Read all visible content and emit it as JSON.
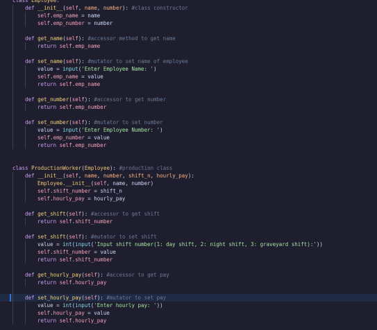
{
  "editor": {
    "lines": [
      {
        "indent": 0,
        "tokens": [
          [
            "kw",
            "class "
          ],
          [
            "cls",
            "Employee"
          ],
          [
            "op",
            ":"
          ]
        ]
      },
      {
        "indent": 1,
        "tokens": [
          [
            "kw",
            "def "
          ],
          [
            "fn",
            "__init__"
          ],
          [
            "op",
            "("
          ],
          [
            "self",
            "self"
          ],
          [
            "op",
            ", "
          ],
          [
            "par",
            "name"
          ],
          [
            "op",
            ", "
          ],
          [
            "par",
            "number"
          ],
          [
            "op",
            "): "
          ],
          [
            "com",
            "#class constructor"
          ]
        ]
      },
      {
        "indent": 2,
        "tokens": [
          [
            "self",
            "self"
          ],
          [
            "op",
            "."
          ],
          [
            "attr",
            "emp_name"
          ],
          [
            "op",
            " = "
          ],
          [
            "var",
            "name"
          ]
        ]
      },
      {
        "indent": 2,
        "tokens": [
          [
            "self",
            "self"
          ],
          [
            "op",
            "."
          ],
          [
            "attr",
            "emp_number"
          ],
          [
            "op",
            " = "
          ],
          [
            "var",
            "number"
          ]
        ]
      },
      {
        "indent": 1,
        "tokens": []
      },
      {
        "indent": 1,
        "tokens": [
          [
            "kw",
            "def "
          ],
          [
            "fn",
            "get_name"
          ],
          [
            "op",
            "("
          ],
          [
            "self",
            "self"
          ],
          [
            "op",
            "): "
          ],
          [
            "com",
            "#accessor method to get name"
          ]
        ]
      },
      {
        "indent": 2,
        "tokens": [
          [
            "kw",
            "return "
          ],
          [
            "self",
            "self"
          ],
          [
            "op",
            "."
          ],
          [
            "attr",
            "emp_name"
          ]
        ]
      },
      {
        "indent": 1,
        "tokens": []
      },
      {
        "indent": 1,
        "tokens": [
          [
            "kw",
            "def "
          ],
          [
            "fn",
            "set_name"
          ],
          [
            "op",
            "("
          ],
          [
            "self",
            "self"
          ],
          [
            "op",
            "): "
          ],
          [
            "com",
            "#mutator to set name of employee"
          ]
        ]
      },
      {
        "indent": 2,
        "tokens": [
          [
            "var",
            "value"
          ],
          [
            "op",
            " = "
          ],
          [
            "bi",
            "input"
          ],
          [
            "op",
            "("
          ],
          [
            "str",
            "'Enter Employee Name: '"
          ],
          [
            "op",
            ")"
          ]
        ]
      },
      {
        "indent": 2,
        "tokens": [
          [
            "self",
            "self"
          ],
          [
            "op",
            "."
          ],
          [
            "attr",
            "emp_name"
          ],
          [
            "op",
            " = "
          ],
          [
            "var",
            "value"
          ]
        ]
      },
      {
        "indent": 2,
        "tokens": [
          [
            "kw",
            "return "
          ],
          [
            "self",
            "self"
          ],
          [
            "op",
            "."
          ],
          [
            "attr",
            "emp_name"
          ]
        ]
      },
      {
        "indent": 1,
        "tokens": []
      },
      {
        "indent": 1,
        "tokens": [
          [
            "kw",
            "def "
          ],
          [
            "fn",
            "get_number"
          ],
          [
            "op",
            "("
          ],
          [
            "self",
            "self"
          ],
          [
            "op",
            "): "
          ],
          [
            "com",
            "#accessor to get number"
          ]
        ]
      },
      {
        "indent": 2,
        "tokens": [
          [
            "kw",
            "return "
          ],
          [
            "self",
            "self"
          ],
          [
            "op",
            "."
          ],
          [
            "attr",
            "emp_number"
          ]
        ]
      },
      {
        "indent": 1,
        "tokens": []
      },
      {
        "indent": 1,
        "tokens": [
          [
            "kw",
            "def "
          ],
          [
            "fn",
            "set_number"
          ],
          [
            "op",
            "("
          ],
          [
            "self",
            "self"
          ],
          [
            "op",
            "): "
          ],
          [
            "com",
            "#mutator to set number"
          ]
        ]
      },
      {
        "indent": 2,
        "tokens": [
          [
            "var",
            "value"
          ],
          [
            "op",
            " = "
          ],
          [
            "bi",
            "input"
          ],
          [
            "op",
            "("
          ],
          [
            "str",
            "'Enter Employee Number: '"
          ],
          [
            "op",
            ")"
          ]
        ]
      },
      {
        "indent": 2,
        "tokens": [
          [
            "self",
            "self"
          ],
          [
            "op",
            "."
          ],
          [
            "attr",
            "emp_number"
          ],
          [
            "op",
            " = "
          ],
          [
            "var",
            "value"
          ]
        ]
      },
      {
        "indent": 2,
        "tokens": [
          [
            "kw",
            "return "
          ],
          [
            "self",
            "self"
          ],
          [
            "op",
            "."
          ],
          [
            "attr",
            "emp_number"
          ]
        ]
      },
      {
        "indent": 0,
        "tokens": []
      },
      {
        "indent": 0,
        "tokens": []
      },
      {
        "indent": 0,
        "tokens": [
          [
            "kw",
            "class "
          ],
          [
            "cls",
            "ProductionWorker"
          ],
          [
            "op",
            "("
          ],
          [
            "cls",
            "Employee"
          ],
          [
            "op",
            "): "
          ],
          [
            "com",
            "#production class"
          ]
        ]
      },
      {
        "indent": 1,
        "tokens": [
          [
            "kw",
            "def "
          ],
          [
            "fn",
            "__init__"
          ],
          [
            "op",
            "("
          ],
          [
            "self",
            "self"
          ],
          [
            "op",
            ", "
          ],
          [
            "par",
            "name"
          ],
          [
            "op",
            ", "
          ],
          [
            "par",
            "number"
          ],
          [
            "op",
            ", "
          ],
          [
            "par",
            "shift_n"
          ],
          [
            "op",
            ", "
          ],
          [
            "par",
            "hourly_pay"
          ],
          [
            "op",
            "):"
          ]
        ]
      },
      {
        "indent": 2,
        "tokens": [
          [
            "cls",
            "Employee"
          ],
          [
            "op",
            "."
          ],
          [
            "fn",
            "__init__"
          ],
          [
            "op",
            "("
          ],
          [
            "self",
            "self"
          ],
          [
            "op",
            ", "
          ],
          [
            "var",
            "name"
          ],
          [
            "op",
            ", "
          ],
          [
            "var",
            "number"
          ],
          [
            "op",
            ")"
          ]
        ]
      },
      {
        "indent": 2,
        "tokens": [
          [
            "self",
            "self"
          ],
          [
            "op",
            "."
          ],
          [
            "attr",
            "shift_number"
          ],
          [
            "op",
            " = "
          ],
          [
            "var",
            "shift_n"
          ]
        ]
      },
      {
        "indent": 2,
        "tokens": [
          [
            "self",
            "self"
          ],
          [
            "op",
            "."
          ],
          [
            "attr",
            "hourly_pay"
          ],
          [
            "op",
            " = "
          ],
          [
            "var",
            "hourly_pay"
          ]
        ]
      },
      {
        "indent": 1,
        "tokens": []
      },
      {
        "indent": 1,
        "tokens": [
          [
            "kw",
            "def "
          ],
          [
            "fn",
            "get_shift"
          ],
          [
            "op",
            "("
          ],
          [
            "self",
            "self"
          ],
          [
            "op",
            "): "
          ],
          [
            "com",
            "#accessor to get shift"
          ]
        ]
      },
      {
        "indent": 2,
        "tokens": [
          [
            "kw",
            "return "
          ],
          [
            "self",
            "self"
          ],
          [
            "op",
            "."
          ],
          [
            "attr",
            "shift_number"
          ]
        ]
      },
      {
        "indent": 1,
        "tokens": []
      },
      {
        "indent": 1,
        "tokens": [
          [
            "kw",
            "def "
          ],
          [
            "fn",
            "set_shift"
          ],
          [
            "op",
            "("
          ],
          [
            "self",
            "self"
          ],
          [
            "op",
            "): "
          ],
          [
            "com",
            "#mutator to set shift"
          ]
        ]
      },
      {
        "indent": 2,
        "tokens": [
          [
            "var",
            "value"
          ],
          [
            "op",
            " = "
          ],
          [
            "bi",
            "int"
          ],
          [
            "op",
            "("
          ],
          [
            "bi",
            "input"
          ],
          [
            "op",
            "("
          ],
          [
            "str",
            "'Input shift number(1: day shift, 2: night shift, 3: graveyard shift):'"
          ],
          [
            "op",
            "))"
          ]
        ]
      },
      {
        "indent": 2,
        "tokens": [
          [
            "self",
            "self"
          ],
          [
            "op",
            "."
          ],
          [
            "attr",
            "shift_number"
          ],
          [
            "op",
            " = "
          ],
          [
            "var",
            "value"
          ]
        ]
      },
      {
        "indent": 2,
        "tokens": [
          [
            "kw",
            "return "
          ],
          [
            "self",
            "self"
          ],
          [
            "op",
            "."
          ],
          [
            "attr",
            "shift_number"
          ]
        ]
      },
      {
        "indent": 1,
        "tokens": []
      },
      {
        "indent": 1,
        "tokens": [
          [
            "kw",
            "def "
          ],
          [
            "fn",
            "get_hourly_pay"
          ],
          [
            "op",
            "("
          ],
          [
            "self",
            "self"
          ],
          [
            "op",
            "): "
          ],
          [
            "com",
            "#accessor to get pay"
          ]
        ]
      },
      {
        "indent": 2,
        "tokens": [
          [
            "kw",
            "return "
          ],
          [
            "self",
            "self"
          ],
          [
            "op",
            "."
          ],
          [
            "attr",
            "hourly_pay"
          ]
        ]
      },
      {
        "indent": 1,
        "tokens": []
      },
      {
        "indent": 1,
        "current": true,
        "tokens": [
          [
            "kw",
            "def "
          ],
          [
            "fn",
            "set_hourly_pay"
          ],
          [
            "op",
            "("
          ],
          [
            "self",
            "self"
          ],
          [
            "op",
            "): "
          ],
          [
            "com",
            "#mutator to set pay"
          ]
        ]
      },
      {
        "indent": 2,
        "tokens": [
          [
            "var",
            "value"
          ],
          [
            "op",
            " = "
          ],
          [
            "bi",
            "int"
          ],
          [
            "op",
            "("
          ],
          [
            "bi",
            "input"
          ],
          [
            "op",
            "("
          ],
          [
            "str",
            "'Enter hourly pay: '"
          ],
          [
            "op",
            "))"
          ]
        ]
      },
      {
        "indent": 2,
        "tokens": [
          [
            "self",
            "self"
          ],
          [
            "op",
            "."
          ],
          [
            "attr",
            "hourly_pay"
          ],
          [
            "op",
            " = "
          ],
          [
            "var",
            "value"
          ]
        ]
      },
      {
        "indent": 2,
        "tokens": [
          [
            "kw",
            "return "
          ],
          [
            "self",
            "self"
          ],
          [
            "op",
            "."
          ],
          [
            "attr",
            "hourly_pay"
          ]
        ]
      }
    ]
  }
}
